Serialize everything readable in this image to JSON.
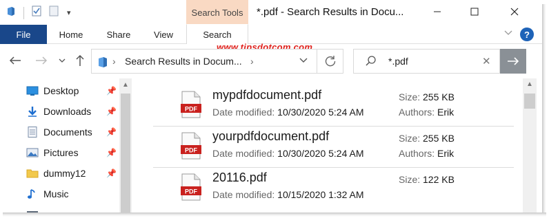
{
  "window": {
    "title": "*.pdf - Search Results in Docu...",
    "context_tab_group": "Search Tools"
  },
  "ribbon": {
    "tabs": [
      {
        "label": "File"
      },
      {
        "label": "Home"
      },
      {
        "label": "Share"
      },
      {
        "label": "View"
      },
      {
        "label": "Search"
      }
    ]
  },
  "watermark": "www.tipsdotcom.com",
  "address_bar": {
    "path": "Search Results in Docum..."
  },
  "search": {
    "query": "*.pdf"
  },
  "nav_pane": {
    "items": [
      {
        "label": "Desktop",
        "icon": "desktop-icon",
        "pinned": true
      },
      {
        "label": "Downloads",
        "icon": "downloads-icon",
        "pinned": true
      },
      {
        "label": "Documents",
        "icon": "documents-icon",
        "pinned": true
      },
      {
        "label": "Pictures",
        "icon": "pictures-icon",
        "pinned": true
      },
      {
        "label": "dummy12",
        "icon": "folder-icon",
        "pinned": true
      },
      {
        "label": "Music",
        "icon": "music-icon",
        "pinned": false
      }
    ]
  },
  "results": {
    "labels": {
      "date": "Date modified:",
      "size": "Size:",
      "authors": "Authors:"
    },
    "files": [
      {
        "name": "mypdfdocument.pdf",
        "date": "10/30/2020 5:24 AM",
        "size": "255 KB",
        "authors": "Erik",
        "icon_text": "PDF"
      },
      {
        "name": "yourpdfdocument.pdf",
        "date": "10/30/2020 5:24 AM",
        "size": "255 KB",
        "authors": "Erik",
        "icon_text": "PDF"
      },
      {
        "name": "20116.pdf",
        "date": "10/15/2020 1:32 AM",
        "size": "122 KB",
        "authors": "",
        "icon_text": "PDF"
      }
    ]
  },
  "colors": {
    "file_tab": "#19478a",
    "context_tab": "#f9d9c3",
    "watermark": "#e0201b",
    "pdf_red": "#c9211e",
    "help": "#1e63b8"
  }
}
